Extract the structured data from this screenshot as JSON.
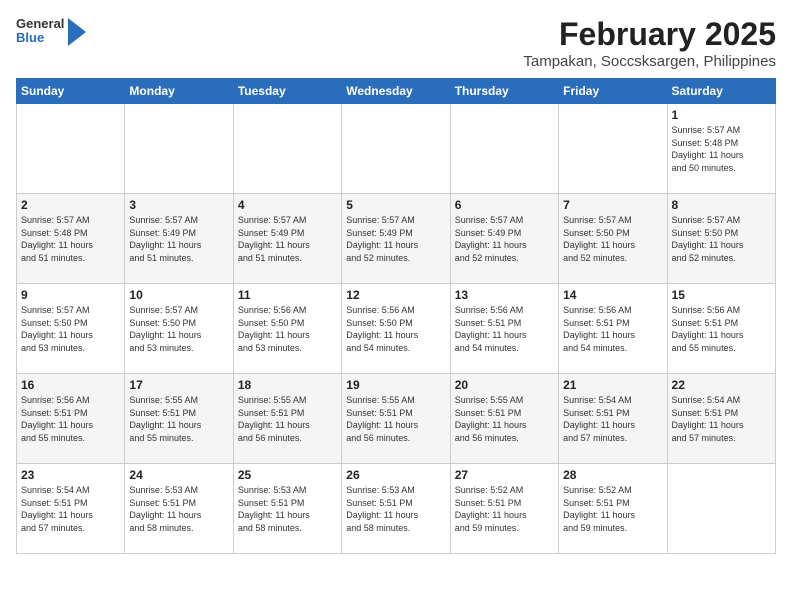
{
  "header": {
    "logo_general": "General",
    "logo_blue": "Blue",
    "month_title": "February 2025",
    "location": "Tampakan, Soccsksargen, Philippines"
  },
  "weekdays": [
    "Sunday",
    "Monday",
    "Tuesday",
    "Wednesday",
    "Thursday",
    "Friday",
    "Saturday"
  ],
  "weeks": [
    [
      {
        "day": "",
        "info": ""
      },
      {
        "day": "",
        "info": ""
      },
      {
        "day": "",
        "info": ""
      },
      {
        "day": "",
        "info": ""
      },
      {
        "day": "",
        "info": ""
      },
      {
        "day": "",
        "info": ""
      },
      {
        "day": "1",
        "info": "Sunrise: 5:57 AM\nSunset: 5:48 PM\nDaylight: 11 hours\nand 50 minutes."
      }
    ],
    [
      {
        "day": "2",
        "info": "Sunrise: 5:57 AM\nSunset: 5:48 PM\nDaylight: 11 hours\nand 51 minutes."
      },
      {
        "day": "3",
        "info": "Sunrise: 5:57 AM\nSunset: 5:49 PM\nDaylight: 11 hours\nand 51 minutes."
      },
      {
        "day": "4",
        "info": "Sunrise: 5:57 AM\nSunset: 5:49 PM\nDaylight: 11 hours\nand 51 minutes."
      },
      {
        "day": "5",
        "info": "Sunrise: 5:57 AM\nSunset: 5:49 PM\nDaylight: 11 hours\nand 52 minutes."
      },
      {
        "day": "6",
        "info": "Sunrise: 5:57 AM\nSunset: 5:49 PM\nDaylight: 11 hours\nand 52 minutes."
      },
      {
        "day": "7",
        "info": "Sunrise: 5:57 AM\nSunset: 5:50 PM\nDaylight: 11 hours\nand 52 minutes."
      },
      {
        "day": "8",
        "info": "Sunrise: 5:57 AM\nSunset: 5:50 PM\nDaylight: 11 hours\nand 52 minutes."
      }
    ],
    [
      {
        "day": "9",
        "info": "Sunrise: 5:57 AM\nSunset: 5:50 PM\nDaylight: 11 hours\nand 53 minutes."
      },
      {
        "day": "10",
        "info": "Sunrise: 5:57 AM\nSunset: 5:50 PM\nDaylight: 11 hours\nand 53 minutes."
      },
      {
        "day": "11",
        "info": "Sunrise: 5:56 AM\nSunset: 5:50 PM\nDaylight: 11 hours\nand 53 minutes."
      },
      {
        "day": "12",
        "info": "Sunrise: 5:56 AM\nSunset: 5:50 PM\nDaylight: 11 hours\nand 54 minutes."
      },
      {
        "day": "13",
        "info": "Sunrise: 5:56 AM\nSunset: 5:51 PM\nDaylight: 11 hours\nand 54 minutes."
      },
      {
        "day": "14",
        "info": "Sunrise: 5:56 AM\nSunset: 5:51 PM\nDaylight: 11 hours\nand 54 minutes."
      },
      {
        "day": "15",
        "info": "Sunrise: 5:56 AM\nSunset: 5:51 PM\nDaylight: 11 hours\nand 55 minutes."
      }
    ],
    [
      {
        "day": "16",
        "info": "Sunrise: 5:56 AM\nSunset: 5:51 PM\nDaylight: 11 hours\nand 55 minutes."
      },
      {
        "day": "17",
        "info": "Sunrise: 5:55 AM\nSunset: 5:51 PM\nDaylight: 11 hours\nand 55 minutes."
      },
      {
        "day": "18",
        "info": "Sunrise: 5:55 AM\nSunset: 5:51 PM\nDaylight: 11 hours\nand 56 minutes."
      },
      {
        "day": "19",
        "info": "Sunrise: 5:55 AM\nSunset: 5:51 PM\nDaylight: 11 hours\nand 56 minutes."
      },
      {
        "day": "20",
        "info": "Sunrise: 5:55 AM\nSunset: 5:51 PM\nDaylight: 11 hours\nand 56 minutes."
      },
      {
        "day": "21",
        "info": "Sunrise: 5:54 AM\nSunset: 5:51 PM\nDaylight: 11 hours\nand 57 minutes."
      },
      {
        "day": "22",
        "info": "Sunrise: 5:54 AM\nSunset: 5:51 PM\nDaylight: 11 hours\nand 57 minutes."
      }
    ],
    [
      {
        "day": "23",
        "info": "Sunrise: 5:54 AM\nSunset: 5:51 PM\nDaylight: 11 hours\nand 57 minutes."
      },
      {
        "day": "24",
        "info": "Sunrise: 5:53 AM\nSunset: 5:51 PM\nDaylight: 11 hours\nand 58 minutes."
      },
      {
        "day": "25",
        "info": "Sunrise: 5:53 AM\nSunset: 5:51 PM\nDaylight: 11 hours\nand 58 minutes."
      },
      {
        "day": "26",
        "info": "Sunrise: 5:53 AM\nSunset: 5:51 PM\nDaylight: 11 hours\nand 58 minutes."
      },
      {
        "day": "27",
        "info": "Sunrise: 5:52 AM\nSunset: 5:51 PM\nDaylight: 11 hours\nand 59 minutes."
      },
      {
        "day": "28",
        "info": "Sunrise: 5:52 AM\nSunset: 5:51 PM\nDaylight: 11 hours\nand 59 minutes."
      },
      {
        "day": "",
        "info": ""
      }
    ]
  ]
}
